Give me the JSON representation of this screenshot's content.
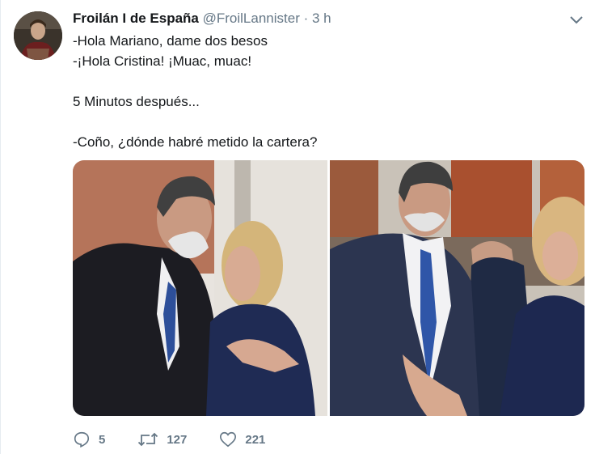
{
  "tweet": {
    "display_name": "Froilán I de España",
    "handle": "@FroilLannister",
    "separator": "·",
    "time": "3 h",
    "lines": [
      "-Hola Mariano, dame dos besos",
      "-¡Hola Cristina! ¡Muac, muac!",
      "",
      "5 Minutos después...",
      "",
      "-Coño, ¿dónde habré metido la cartera?"
    ]
  },
  "actions": {
    "reply_count": "5",
    "retweet_count": "127",
    "like_count": "221"
  },
  "icons": {
    "menu": "chevron-down-icon",
    "reply": "reply-icon",
    "retweet": "retweet-icon",
    "like": "heart-icon"
  },
  "colors": {
    "text": "#14171a",
    "muted": "#657786",
    "border": "#e6ecf0"
  }
}
